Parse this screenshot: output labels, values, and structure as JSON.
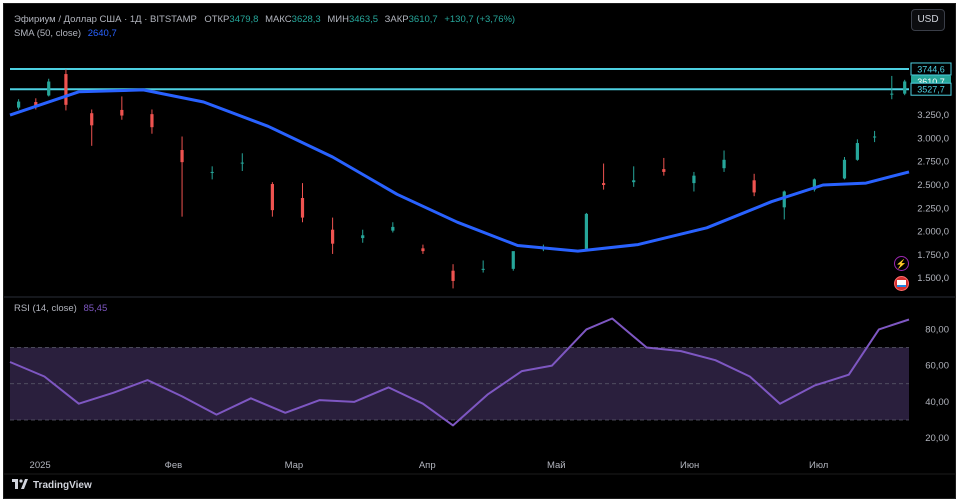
{
  "header": {
    "symbol": "Эфириум / Доллар США · 1Д · BITSTAMP",
    "open_label": "ОТКР",
    "open_value": "3479,8",
    "high_label": "МАКС",
    "high_value": "3628,3",
    "low_label": "МИН",
    "low_value": "3463,5",
    "close_label": "ЗАКР",
    "close_value": "3610,7",
    "change": "+130,7 (+3,76%)"
  },
  "currency_button": "USD",
  "sma_legend": {
    "label": "SMA (50, close)",
    "value": "2640,7"
  },
  "rsi_legend": {
    "label": "RSI (14, close)",
    "value": "85,45"
  },
  "brand": "TradingView",
  "icons": [
    "lightning-icon",
    "flag-icon",
    "tradingview-logo-icon"
  ],
  "colors": {
    "up": "#26a69a",
    "down": "#ef5350",
    "sma": "#2962ff",
    "rsi": "#7e57c2",
    "hline": "#4dd0e1",
    "band": "#2a1f3d"
  },
  "chart_data": {
    "type": "candlestick",
    "price_axis": {
      "ticks": [
        1500,
        1750,
        2000,
        2250,
        2500,
        2750,
        3000,
        3250
      ],
      "tick_labels": [
        "1.500,0",
        "1.750,0",
        "2.000,0",
        "2.250,0",
        "2.500,0",
        "2.750,0",
        "3.000,0",
        "3.250,0"
      ],
      "ylim": [
        1330,
        4120
      ]
    },
    "x_axis": {
      "labels": [
        "2025",
        "Фев",
        "Мар",
        "Апр",
        "Май",
        "Июн",
        "Июл"
      ],
      "dates": [
        "2025-01-01",
        "2025-02-01",
        "2025-03-01",
        "2025-04-01",
        "2025-05-01",
        "2025-06-01",
        "2025-07-01"
      ],
      "range": [
        "2024-12-25",
        "2025-07-22"
      ]
    },
    "horizontal_lines": [
      {
        "value": 3744.6,
        "label": "3744,6"
      },
      {
        "value": 3527.7,
        "label": "3527,7"
      }
    ],
    "last_price": {
      "value": 3610.7,
      "label": "3610,7"
    },
    "candles_close_estimate": [
      {
        "date": "2024-12-27",
        "open": 3330,
        "high": 3420,
        "low": 3310,
        "close": 3395
      },
      {
        "date": "2024-12-31",
        "open": 3390,
        "high": 3430,
        "low": 3310,
        "close": 3335
      },
      {
        "date": "2025-01-03",
        "open": 3460,
        "high": 3640,
        "low": 3450,
        "close": 3610
      },
      {
        "date": "2025-01-07",
        "open": 3690,
        "high": 3740,
        "low": 3300,
        "close": 3360
      },
      {
        "date": "2025-01-13",
        "open": 3270,
        "high": 3310,
        "low": 2920,
        "close": 3140
      },
      {
        "date": "2025-01-20",
        "open": 3305,
        "high": 3450,
        "low": 3200,
        "close": 3245
      },
      {
        "date": "2025-01-27",
        "open": 3260,
        "high": 3310,
        "low": 3050,
        "close": 3120
      },
      {
        "date": "2025-02-03",
        "open": 2875,
        "high": 3020,
        "low": 2160,
        "close": 2745
      },
      {
        "date": "2025-02-10",
        "open": 2630,
        "high": 2700,
        "low": 2560,
        "close": 2640
      },
      {
        "date": "2025-02-17",
        "open": 2740,
        "high": 2840,
        "low": 2650,
        "close": 2740
      },
      {
        "date": "2025-02-24",
        "open": 2510,
        "high": 2530,
        "low": 2160,
        "close": 2230
      },
      {
        "date": "2025-03-03",
        "open": 2360,
        "high": 2520,
        "low": 2100,
        "close": 2150
      },
      {
        "date": "2025-03-10",
        "open": 2020,
        "high": 2150,
        "low": 1760,
        "close": 1870
      },
      {
        "date": "2025-03-17",
        "open": 1930,
        "high": 2020,
        "low": 1880,
        "close": 1960
      },
      {
        "date": "2025-03-24",
        "open": 2010,
        "high": 2100,
        "low": 1990,
        "close": 2050
      },
      {
        "date": "2025-03-31",
        "open": 1820,
        "high": 1860,
        "low": 1760,
        "close": 1790
      },
      {
        "date": "2025-04-07",
        "open": 1580,
        "high": 1650,
        "low": 1390,
        "close": 1470
      },
      {
        "date": "2025-04-14",
        "open": 1590,
        "high": 1690,
        "low": 1560,
        "close": 1600
      },
      {
        "date": "2025-04-21",
        "open": 1600,
        "high": 1760,
        "low": 1580,
        "close": 1790
      },
      {
        "date": "2025-04-28",
        "open": 1820,
        "high": 1860,
        "low": 1790,
        "close": 1820
      },
      {
        "date": "2025-05-08",
        "open": 1810,
        "high": 2200,
        "low": 1800,
        "close": 2190
      },
      {
        "date": "2025-05-12",
        "open": 2520,
        "high": 2730,
        "low": 2450,
        "close": 2500
      },
      {
        "date": "2025-05-19",
        "open": 2530,
        "high": 2700,
        "low": 2480,
        "close": 2550
      },
      {
        "date": "2025-05-26",
        "open": 2670,
        "high": 2790,
        "low": 2600,
        "close": 2640
      },
      {
        "date": "2025-06-02",
        "open": 2520,
        "high": 2640,
        "low": 2430,
        "close": 2600
      },
      {
        "date": "2025-06-09",
        "open": 2680,
        "high": 2870,
        "low": 2640,
        "close": 2770
      },
      {
        "date": "2025-06-16",
        "open": 2550,
        "high": 2620,
        "low": 2380,
        "close": 2420
      },
      {
        "date": "2025-06-23",
        "open": 2260,
        "high": 2440,
        "low": 2130,
        "close": 2430
      },
      {
        "date": "2025-06-30",
        "open": 2450,
        "high": 2570,
        "low": 2430,
        "close": 2560
      },
      {
        "date": "2025-07-07",
        "open": 2570,
        "high": 2800,
        "low": 2560,
        "close": 2770
      },
      {
        "date": "2025-07-10",
        "open": 2770,
        "high": 2990,
        "low": 2760,
        "close": 2950
      },
      {
        "date": "2025-07-14",
        "open": 3010,
        "high": 3080,
        "low": 2960,
        "close": 3020
      },
      {
        "date": "2025-07-18",
        "open": 3470,
        "high": 3670,
        "low": 3420,
        "close": 3480
      },
      {
        "date": "2025-07-21",
        "open": 3479.8,
        "high": 3628.3,
        "low": 3463.5,
        "close": 3610.7
      }
    ],
    "sma": [
      {
        "date": "2024-12-25",
        "value": 3250
      },
      {
        "date": "2025-01-10",
        "value": 3500
      },
      {
        "date": "2025-01-25",
        "value": 3520
      },
      {
        "date": "2025-02-08",
        "value": 3390
      },
      {
        "date": "2025-02-23",
        "value": 3130
      },
      {
        "date": "2025-03-10",
        "value": 2800
      },
      {
        "date": "2025-03-25",
        "value": 2400
      },
      {
        "date": "2025-04-08",
        "value": 2100
      },
      {
        "date": "2025-04-22",
        "value": 1850
      },
      {
        "date": "2025-05-06",
        "value": 1790
      },
      {
        "date": "2025-05-20",
        "value": 1860
      },
      {
        "date": "2025-06-05",
        "value": 2040
      },
      {
        "date": "2025-06-20",
        "value": 2320
      },
      {
        "date": "2025-07-02",
        "value": 2500
      },
      {
        "date": "2025-07-12",
        "value": 2520
      },
      {
        "date": "2025-07-22",
        "value": 2640.7
      }
    ],
    "rsi": {
      "ylim": [
        14,
        94
      ],
      "ticks": [
        20,
        40,
        60,
        80
      ],
      "tick_labels": [
        "20,00",
        "40,00",
        "60,00",
        "80,00"
      ],
      "band": [
        30,
        70
      ],
      "mid": 50,
      "series": [
        {
          "date": "2024-12-25",
          "value": 62
        },
        {
          "date": "2025-01-02",
          "value": 54
        },
        {
          "date": "2025-01-10",
          "value": 39
        },
        {
          "date": "2025-01-18",
          "value": 45
        },
        {
          "date": "2025-01-26",
          "value": 52
        },
        {
          "date": "2025-02-03",
          "value": 43
        },
        {
          "date": "2025-02-11",
          "value": 33
        },
        {
          "date": "2025-02-19",
          "value": 42
        },
        {
          "date": "2025-02-27",
          "value": 34
        },
        {
          "date": "2025-03-07",
          "value": 41
        },
        {
          "date": "2025-03-15",
          "value": 40
        },
        {
          "date": "2025-03-23",
          "value": 48
        },
        {
          "date": "2025-03-31",
          "value": 39
        },
        {
          "date": "2025-04-07",
          "value": 27
        },
        {
          "date": "2025-04-15",
          "value": 44
        },
        {
          "date": "2025-04-23",
          "value": 57
        },
        {
          "date": "2025-04-30",
          "value": 60
        },
        {
          "date": "2025-05-08",
          "value": 80
        },
        {
          "date": "2025-05-14",
          "value": 86
        },
        {
          "date": "2025-05-22",
          "value": 70
        },
        {
          "date": "2025-05-30",
          "value": 68
        },
        {
          "date": "2025-06-07",
          "value": 63
        },
        {
          "date": "2025-06-15",
          "value": 54
        },
        {
          "date": "2025-06-22",
          "value": 39
        },
        {
          "date": "2025-06-30",
          "value": 49
        },
        {
          "date": "2025-07-08",
          "value": 55
        },
        {
          "date": "2025-07-15",
          "value": 80
        },
        {
          "date": "2025-07-22",
          "value": 85.45
        }
      ]
    }
  }
}
